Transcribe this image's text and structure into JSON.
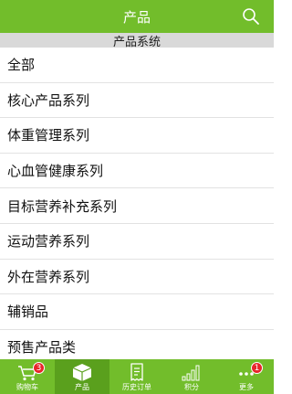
{
  "header": {
    "title": "产品"
  },
  "section": {
    "title": "产品系统"
  },
  "categories": [
    {
      "label": "全部"
    },
    {
      "label": "核心产品系列"
    },
    {
      "label": "体重管理系列"
    },
    {
      "label": "心血管健康系列"
    },
    {
      "label": "目标营养补充系列"
    },
    {
      "label": "运动营养系列"
    },
    {
      "label": "外在营养系列"
    },
    {
      "label": "辅销品"
    },
    {
      "label": "预售产品类"
    }
  ],
  "tabs": {
    "cart": {
      "label": "购物车",
      "badge": "3"
    },
    "products": {
      "label": "产品"
    },
    "orders": {
      "label": "历史订单"
    },
    "points": {
      "label": "积分"
    },
    "more": {
      "label": "更多",
      "badge": "1"
    }
  },
  "colors": {
    "brand": "#72bd2b",
    "active_tab": "#5aa01d",
    "badge": "#e8262b"
  }
}
